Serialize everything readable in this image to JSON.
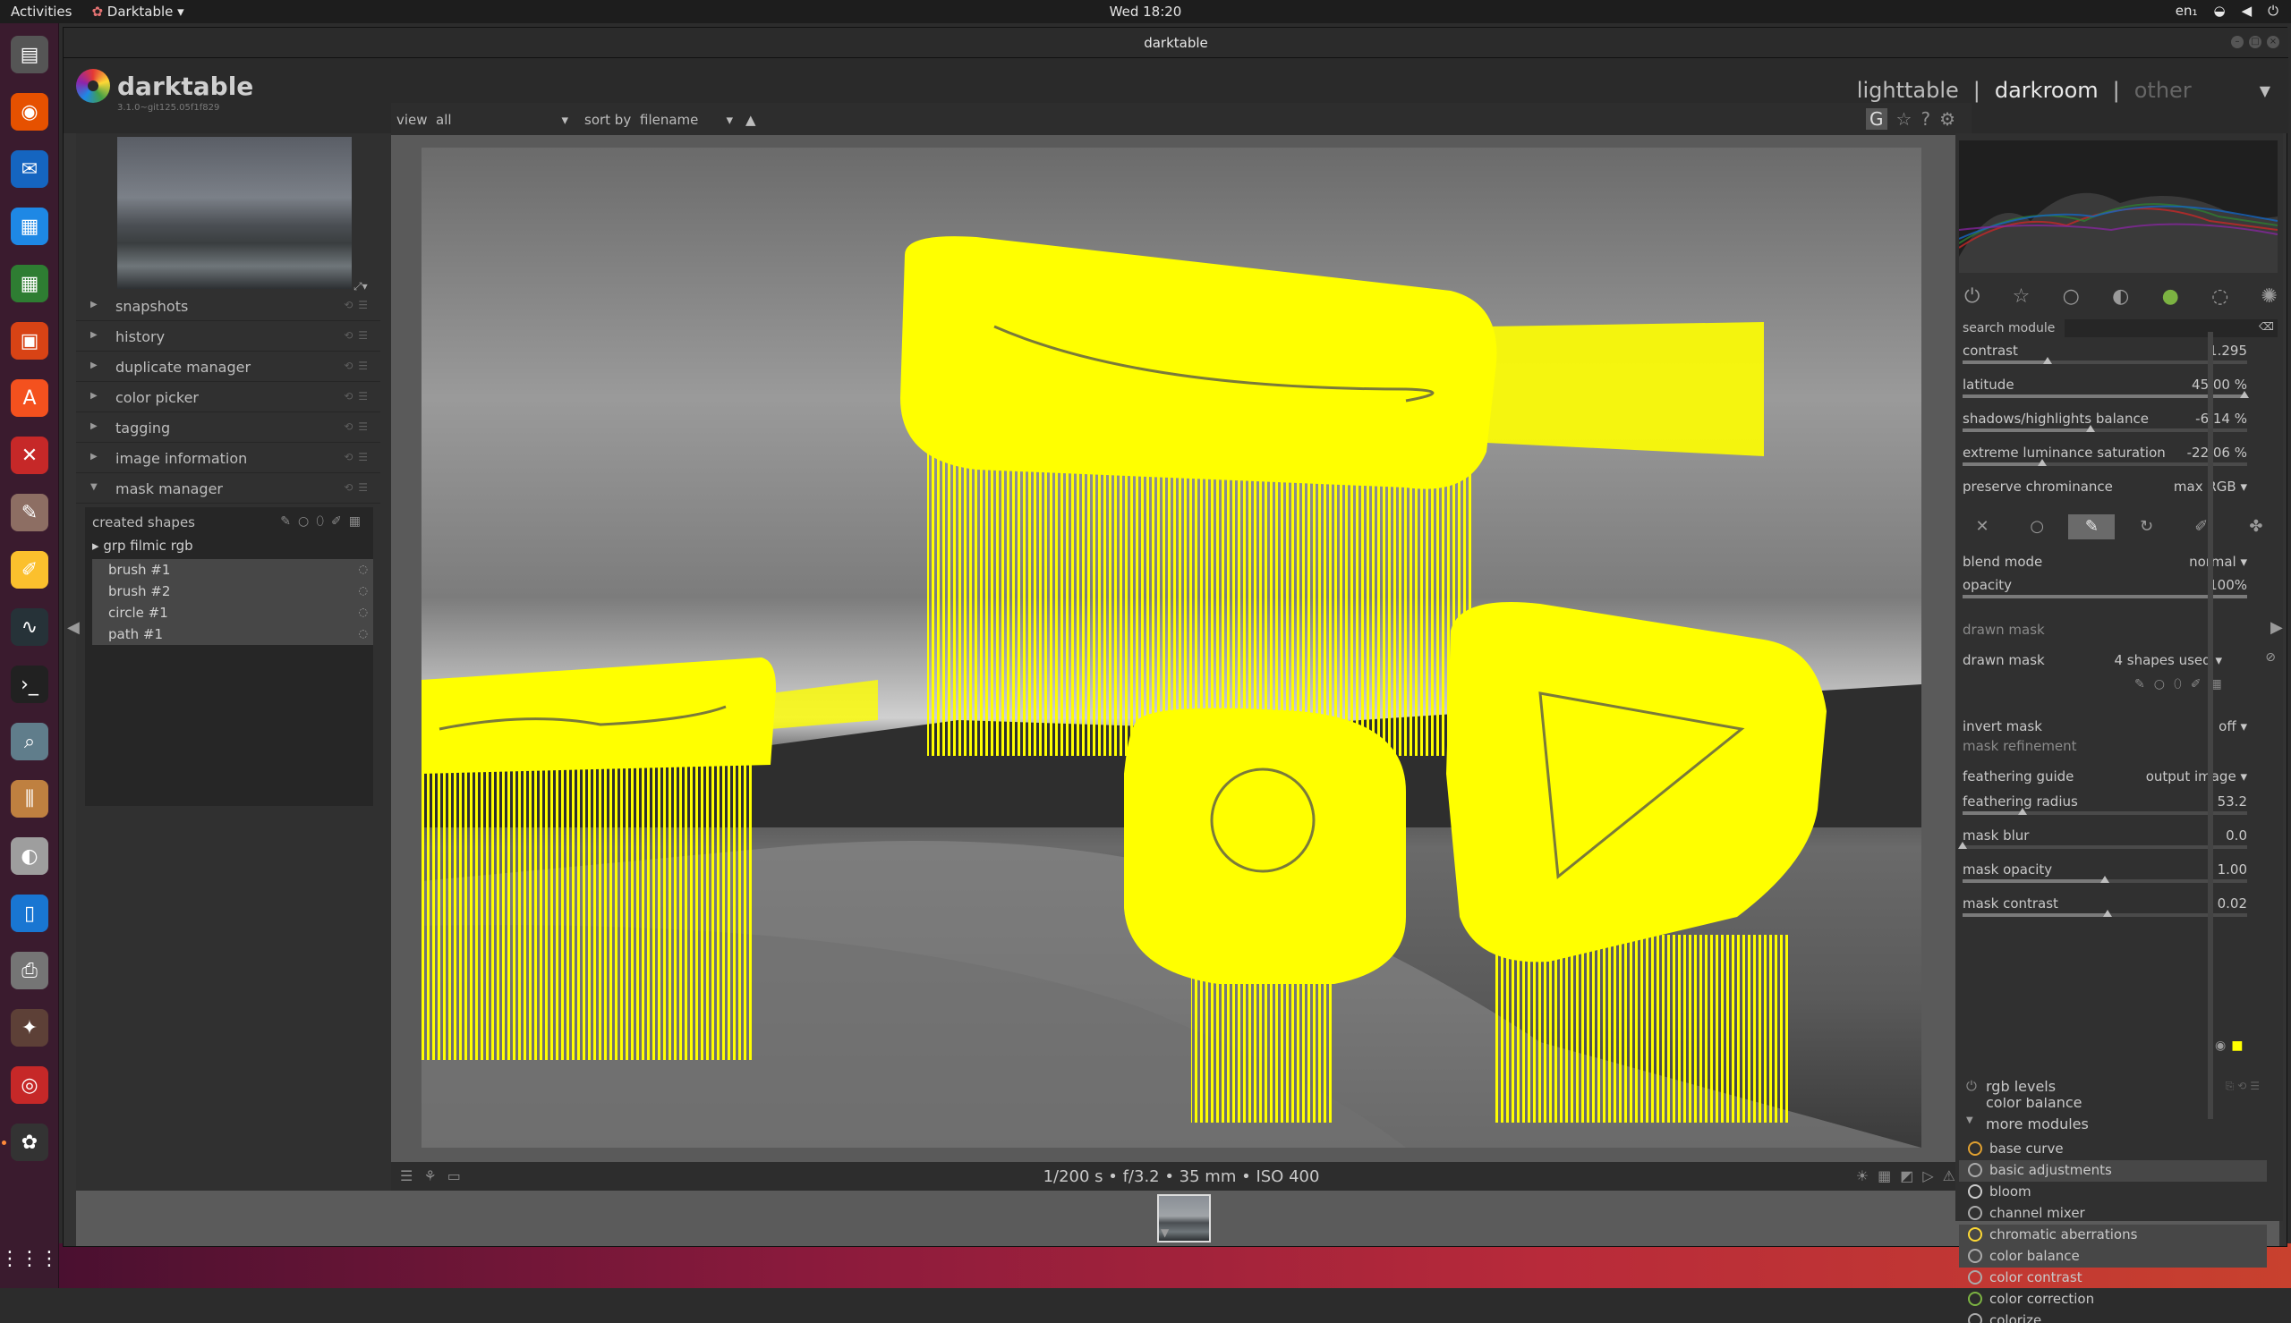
{
  "topbar": {
    "activities": "Activities",
    "app_menu": "Darktable",
    "clock": "Wed 18:20",
    "lang": "en₁",
    "sys_icons": [
      "network-icon",
      "volume-icon",
      "power-icon"
    ]
  },
  "window": {
    "title": "darktable"
  },
  "header": {
    "logo_name": "darktable",
    "version": "3.1.0~git125.05f1f829",
    "views": {
      "lighttable": "lighttable",
      "sep1": "|",
      "darkroom": "darkroom",
      "sep2": "|",
      "other": "other"
    }
  },
  "filterbar": {
    "view_label": "view",
    "view_value": "all",
    "sort_label": "sort by",
    "sort_value": "filename",
    "sort_dir": "▲",
    "g_label": "G"
  },
  "left_modules": [
    {
      "label": "snapshots",
      "expanded": false
    },
    {
      "label": "history",
      "expanded": false
    },
    {
      "label": "duplicate manager",
      "expanded": false
    },
    {
      "label": "color picker",
      "expanded": false
    },
    {
      "label": "tagging",
      "expanded": false
    },
    {
      "label": "image information",
      "expanded": false
    },
    {
      "label": "mask manager",
      "expanded": true
    }
  ],
  "mask_manager": {
    "header": "created shapes",
    "group": "grp filmic rgb",
    "shapes": [
      "brush #1",
      "brush #2",
      "circle #1",
      "path #1"
    ]
  },
  "bottom": {
    "exif": "1/200 s • f/3.2 • 35 mm • ISO 400"
  },
  "right": {
    "search_label": "search module",
    "params_top": [
      {
        "label": "contrast",
        "value": "1.295",
        "pos": 0.3
      },
      {
        "label": "latitude",
        "value": "45.00 %",
        "pos": 0.99
      },
      {
        "label": "shadows/highlights balance",
        "value": "-6.14 %",
        "pos": 0.45
      },
      {
        "label": "extreme luminance saturation",
        "value": "-22.06 %",
        "pos": 0.28
      }
    ],
    "preserve_label": "preserve chrominance",
    "preserve_value": "max RGB",
    "blend_mode_label": "blend mode",
    "blend_mode_value": "normal",
    "opacity_label": "opacity",
    "opacity_value": "100%",
    "drawn_mask_section": "drawn mask",
    "drawn_mask_label": "drawn mask",
    "drawn_mask_value": "4 shapes used",
    "invert_label": "invert mask",
    "invert_value": "off",
    "refine_section": "mask refinement",
    "feather_guide_label": "feathering guide",
    "feather_guide_value": "output image",
    "params_refine": [
      {
        "label": "feathering radius",
        "value": "53.2",
        "pos": 0.21
      },
      {
        "label": "mask blur",
        "value": "0.0",
        "pos": 0.0
      },
      {
        "label": "mask opacity",
        "value": "1.00",
        "pos": 0.5
      },
      {
        "label": "mask contrast",
        "value": "0.02",
        "pos": 0.51
      }
    ],
    "rgb_levels": "rgb levels",
    "color_balance_cut": "color balance",
    "more_modules": "more modules",
    "more_list": [
      {
        "label": "base curve",
        "hl": false,
        "color": "#e0a030"
      },
      {
        "label": "basic adjustments",
        "hl": true,
        "color": "#aaaaaa"
      },
      {
        "label": "bloom",
        "hl": false,
        "color": "#cccccc"
      },
      {
        "label": "channel mixer",
        "hl": false,
        "color": "#aaaaaa"
      },
      {
        "label": "chromatic aberrations",
        "hl": true,
        "color": "#fdd835"
      },
      {
        "label": "color balance",
        "hl": true,
        "color": "#aaaaaa"
      },
      {
        "label": "color contrast",
        "hl": false,
        "color": "#aaaaaa"
      },
      {
        "label": "color correction",
        "hl": false,
        "color": "#7cb342"
      },
      {
        "label": "colorize",
        "hl": false,
        "color": "#aaaaaa"
      }
    ]
  },
  "colors": {
    "mask_yellow": "#ffff00",
    "panel_bg": "#303030",
    "accent_orange": "#ff8a3a"
  }
}
